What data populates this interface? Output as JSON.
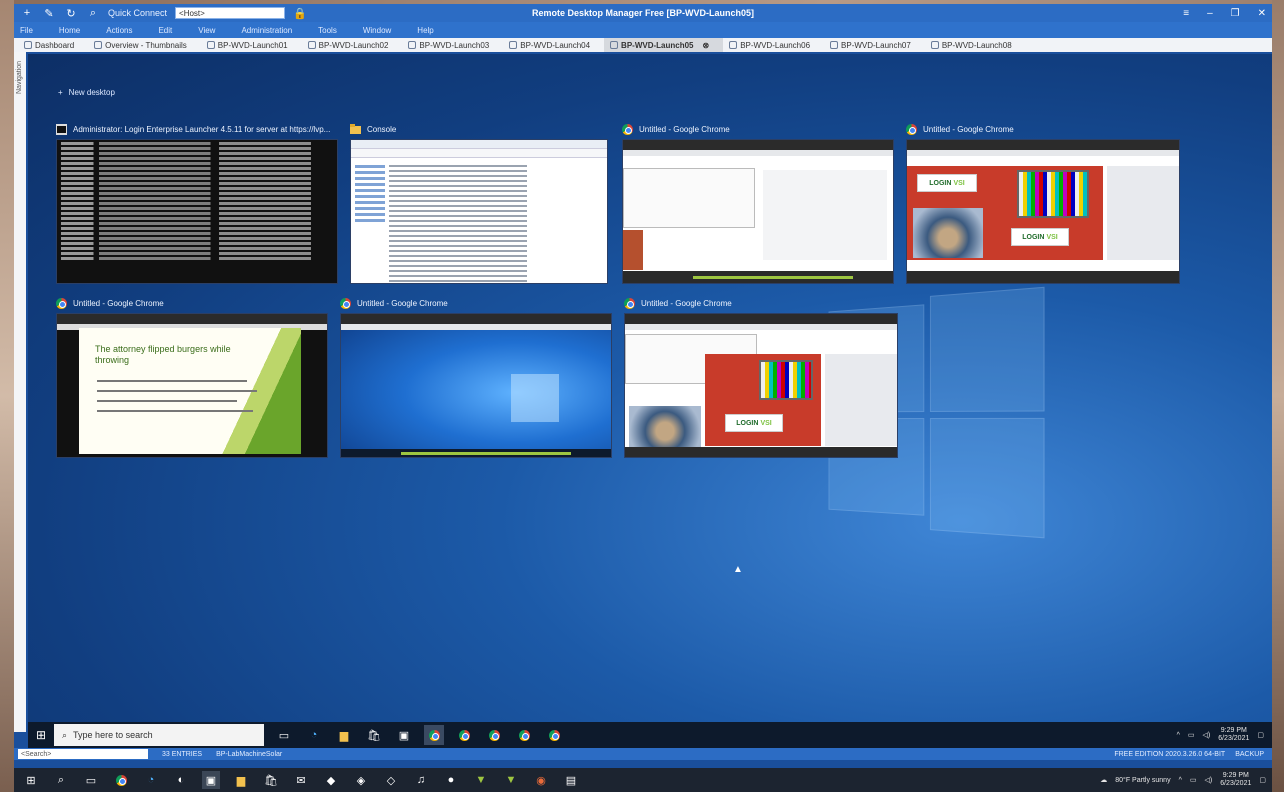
{
  "app": {
    "title": "Remote Desktop Manager Free [BP-WVD-Launch05]",
    "quick_connect_label": "Quick Connect",
    "quick_connect_value": "<Host>",
    "menu": [
      "File",
      "Home",
      "Actions",
      "Edit",
      "View",
      "Administration",
      "Tools",
      "Window",
      "Help"
    ],
    "tabs": [
      "Dashboard",
      "Overview - Thumbnails",
      "BP-WVD-Launch01",
      "BP-WVD-Launch02",
      "BP-WVD-Launch03",
      "BP-WVD-Launch04",
      "BP-WVD-Launch05",
      "BP-WVD-Launch06",
      "BP-WVD-Launch07",
      "BP-WVD-Launch08"
    ],
    "active_tab_index": 6,
    "side_label": "Navigation"
  },
  "desktop": {
    "new_desktop_label": "New desktop",
    "windows": [
      {
        "title": "Administrator: Login Enterprise Launcher 4.5.11 for server at https://lvp...",
        "kind": "console"
      },
      {
        "title": "Console",
        "kind": "explorer"
      },
      {
        "title": "Untitled - Google Chrome",
        "kind": "chrome-app"
      },
      {
        "title": "Untitled - Google Chrome",
        "kind": "chrome-paint"
      },
      {
        "title": "Untitled - Google Chrome",
        "kind": "chrome-slide"
      },
      {
        "title": "Untitled - Google Chrome",
        "kind": "chrome-desktop"
      },
      {
        "title": "Untitled - Google Chrome",
        "kind": "chrome-paint2"
      }
    ],
    "slide_title": "The attorney flipped burgers while throwing",
    "brand": {
      "prefix": "LOGIN",
      "suffix": "VSI"
    }
  },
  "remote_taskbar": {
    "search_placeholder": "Type here to search",
    "time": "9:29 PM",
    "date": "6/23/2021"
  },
  "statusbar": {
    "search_value": "<Search>",
    "entries": "33 ENTRIES",
    "machine": "BP-LabMachineSolar",
    "edition": "FREE EDITION 2020.3.26.0 64-BIT",
    "backup": "BACKUP"
  },
  "host_taskbar": {
    "weather": "80°F Partly sunny",
    "time": "9:29 PM",
    "date": "6/23/2021"
  },
  "colors": {
    "accent": "#2c6cc4",
    "desktop": "#1c5aa8",
    "chrome_paint": "#c83b2a"
  }
}
